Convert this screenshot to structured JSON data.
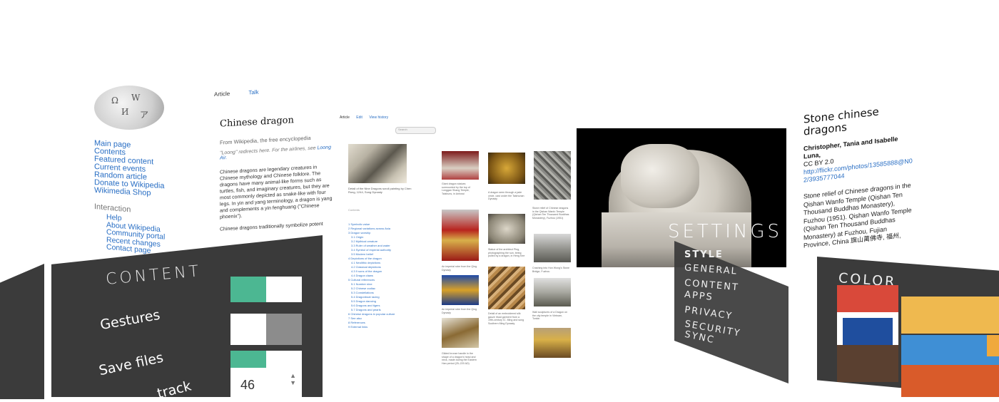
{
  "wiki_nav": {
    "main": [
      "Main page",
      "Contents",
      "Featured content",
      "Current events",
      "Random article",
      "Donate to Wikipedia",
      "Wikimedia Shop"
    ],
    "interaction_heading": "Interaction",
    "interaction": [
      "Help",
      "About Wikipedia",
      "Community portal",
      "Recent changes",
      "Contact page"
    ]
  },
  "article": {
    "tab_article": "Article",
    "tab_talk": "Talk",
    "title": "Chinese dragon",
    "from": "From Wikipedia, the free encyclopedia",
    "hatnote_prefix": "\"Loong\" redirects here. For the airlines, see",
    "hatnote_link": "Loong Air.",
    "intro": "Chinese dragons are legendary creatures in Chinese mythology and Chinese folklore. The dragons have many animal-like forms such as turtles, fish, and imaginary creatures, but they are most commonly depicted as snake-like with four legs. In yin and yang terminology, a dragon is yang and complements a yin fenghuang (\"Chinese phoenix\").",
    "para2": "Chinese dragons traditionally symbolize potent"
  },
  "page2": {
    "tab_article": "Article",
    "tab_edit": "Edit",
    "tab_history": "View history",
    "search_placeholder": "Search",
    "caption": "Detail of the Nine Dragons scroll painting by Chen Rong, 1244, Song Dynasty",
    "toc_title": "Contents",
    "toc": [
      "1 Symbolic value",
      "2 Regional variations across Asia",
      "3 Dragon worship",
      "3.1 Origin",
      "3.2 Mythical creature",
      "3.3 Ruler of weather and water",
      "3.4 Symbol of imperial authority",
      "3.5 Modern belief",
      "4 Depictions of the dragon",
      "4.1 Neolithic depictions",
      "4.2 Classical depictions",
      "4.3 9 sons of the dragon",
      "4.4 Dragon claws",
      "5 Cultural references",
      "5.1 Number nine",
      "5.2 Chinese zodiac",
      "5.3 Constellations",
      "5.4 Dragonboat racing",
      "5.5 Dragon dancing",
      "5.6 Dragons and tigers",
      "5.7 Dragons and pearls",
      "6 Chinese dragons in popular culture",
      "7 See also",
      "8 References",
      "9 External links"
    ]
  },
  "gallery": {
    "captions": [
      "Giant dragon statues surmounted by the top of Longgan Shang Temple, Taishuns, in Anhwai",
      "A dragon seen through a jade circle, cast under the Taishunan Dynasty",
      "Stone relief of Chinese dragons in the Qishan Wanfo Temple (Qishan Ten Thousand Buddhas Monastery), Fuzhou (1951)",
      "An imperial robe from the Qing Dynasty",
      "Statue of the architect Ping, photographing the sun, being pulled by a dragon, in Heng Kee",
      "Crashing into Hon Wong's Stone Bridge, Fuzhou",
      "An imperial robe from the Qing Dynasty",
      "Detail of an embroidered silk gauze ritual garment from a 19th-century IC. Ming and song Southern Ming Dynasty",
      "Wall sculptures of a Dragon on the city temple in Vietnam, Tonkin",
      "Gilded bronze handle in the shape of a dragon's head and neck, made during the Eastern Han period (25–220 AD)"
    ]
  },
  "featured_image": {
    "overlay_title": "SETTINGS"
  },
  "details": {
    "title": "Stone chinese dragons",
    "author": "Christopher, Tania and Isabelle Luna,",
    "license": "CC BY 2.0",
    "url": "http://flickr.com/photos/13585888@N02/3935777044",
    "description": "Stone relief of Chinese dragons in the Qishan Wanfo Temple (Qishan Ten Thousand Buddhas Monastery), Fuzhou (1951). Qishan Wanfo Temple (Qishan Ten Thousand Buddhas Monastery) at Fuzhou, Fujian Province, China 旗山萬佛寺, 福州,"
  },
  "content_panel": {
    "title": "CONTENT",
    "gestures_label": "Gestures",
    "save_files_label": "Save files",
    "track_label": "track",
    "stepper_value": "46",
    "toggles": [
      {
        "name": "content-toggle",
        "state": "on"
      },
      {
        "name": "gestures-toggle",
        "state": "off"
      },
      {
        "name": "save-files-toggle",
        "state": "on"
      }
    ],
    "colors": {
      "on": "#4cb792",
      "off_light": "#ffffff",
      "off_dark": "#8c8c8c",
      "panel": "#3a3a3a"
    }
  },
  "settings_menu": {
    "items": [
      "STYLE",
      "GENERAL",
      "CONTENT",
      "APPS",
      "PRIVACY",
      "SECURITY",
      "SYNC"
    ],
    "selected": "STYLE"
  },
  "color_panel": {
    "title": "COLOR",
    "swatches": [
      "#d9493a",
      "#efb94f",
      "#1f4e9e",
      "#ffffff",
      "#5a4030",
      "#3f8fd5",
      "#d95b2a",
      "#f0a93c"
    ],
    "selected_swatch": "#1f4e9e"
  }
}
